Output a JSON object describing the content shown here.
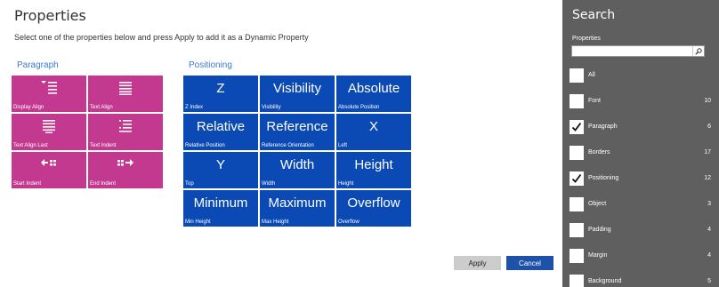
{
  "header": {
    "title": "Properties",
    "subtitle": "Select one of the properties below and press Apply to add it as a Dynamic Property"
  },
  "paragraph": {
    "label": "Paragraph",
    "color": "#c3398f",
    "tiles": [
      {
        "caption": "Display Align",
        "icon": "display-align-icon"
      },
      {
        "caption": "Text Align",
        "icon": "text-align-icon"
      },
      {
        "caption": "Text Align Last",
        "icon": "text-align-last-icon"
      },
      {
        "caption": "Text Indent",
        "icon": "text-indent-icon"
      },
      {
        "caption": "Start Indent",
        "icon": "start-indent-icon"
      },
      {
        "caption": "End Indent",
        "icon": "end-indent-icon"
      }
    ]
  },
  "positioning": {
    "label": "Positioning",
    "color": "#0b4ab4",
    "tiles": [
      {
        "big": "Z",
        "caption": "Z Index"
      },
      {
        "big": "Visibility",
        "caption": "Visibility"
      },
      {
        "big": "Absolute",
        "caption": "Absolute Position"
      },
      {
        "big": "Relative",
        "caption": "Relative Position"
      },
      {
        "big": "Reference",
        "caption": "Reference Orientation"
      },
      {
        "big": "X",
        "caption": "Left"
      },
      {
        "big": "Y",
        "caption": "Top"
      },
      {
        "big": "Width",
        "caption": "Width"
      },
      {
        "big": "Height",
        "caption": "Height"
      },
      {
        "big": "Minimum",
        "caption": "Min Height"
      },
      {
        "big": "Maximum",
        "caption": "Max Height"
      },
      {
        "big": "Overflow",
        "caption": "Overflow"
      }
    ]
  },
  "buttons": {
    "apply": "Apply",
    "cancel": "Cancel"
  },
  "search_panel": {
    "title": "Search",
    "label": "Properties",
    "search_value": "",
    "filters": [
      {
        "name": "All",
        "count": "",
        "checked": false
      },
      {
        "name": "Font",
        "count": "10",
        "checked": false
      },
      {
        "name": "Paragraph",
        "count": "6",
        "checked": true
      },
      {
        "name": "Borders",
        "count": "17",
        "checked": false
      },
      {
        "name": "Positioning",
        "count": "12",
        "checked": true
      },
      {
        "name": "Object",
        "count": "3",
        "checked": false
      },
      {
        "name": "Padding",
        "count": "4",
        "checked": false
      },
      {
        "name": "Margin",
        "count": "4",
        "checked": false
      },
      {
        "name": "Background",
        "count": "5",
        "checked": false
      }
    ]
  }
}
